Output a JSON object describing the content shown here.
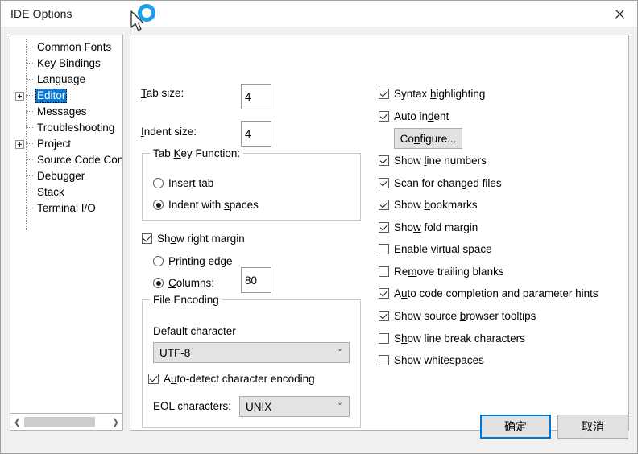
{
  "window": {
    "title": "IDE Options",
    "close_icon": "close-icon",
    "busy_indicator": "loading-spinner-icon"
  },
  "tree": {
    "items": [
      {
        "label": "Common Fonts",
        "expandable": false,
        "selected": false
      },
      {
        "label": "Key Bindings",
        "expandable": false,
        "selected": false
      },
      {
        "label": "Language",
        "expandable": false,
        "selected": false
      },
      {
        "label": "Editor",
        "expandable": true,
        "selected": true
      },
      {
        "label": "Messages",
        "expandable": false,
        "selected": false
      },
      {
        "label": "Troubleshooting",
        "expandable": false,
        "selected": false
      },
      {
        "label": "Project",
        "expandable": true,
        "selected": false
      },
      {
        "label": "Source Code Contro",
        "expandable": false,
        "selected": false
      },
      {
        "label": "Debugger",
        "expandable": false,
        "selected": false
      },
      {
        "label": "Stack",
        "expandable": false,
        "selected": false
      },
      {
        "label": "Terminal I/O",
        "expandable": false,
        "selected": false
      }
    ],
    "scrollbar": {
      "left_arrow": "chevron-left-icon",
      "right_arrow": "chevron-right-icon"
    }
  },
  "editor_page": {
    "tab_size": {
      "label": "Tab size:",
      "mnemonic": "T",
      "value": "4"
    },
    "indent_size": {
      "label": "Indent size:",
      "mnemonic": "I",
      "value": "4"
    },
    "tab_key_function": {
      "title": "Tab Key Function:",
      "options": [
        {
          "label": "Insert tab",
          "mnemonic": "r",
          "checked": false
        },
        {
          "label": "Indent with spaces",
          "mnemonic": "s",
          "checked": true
        }
      ]
    },
    "show_right_margin": {
      "label": "Show right margin",
      "mnemonic": "o",
      "checked": true
    },
    "margin_options": [
      {
        "label": "Printing edge",
        "mnemonic": "P",
        "checked": false
      },
      {
        "label": "Columns:",
        "mnemonic": "C",
        "checked": true
      }
    ],
    "columns_value": "80",
    "file_encoding": {
      "title": "File Encoding",
      "default_character_label": "Default character",
      "default_character_value": "UTF-8",
      "auto_detect": {
        "label": "Auto-detect character encoding",
        "mnemonic": "u",
        "checked": true
      },
      "eol_label": "EOL characters:",
      "eol_mnemonic": "a",
      "eol_value": "UNIX",
      "dropdown_icon": "chevron-down-icon"
    },
    "right_options": [
      {
        "label": "Syntax highlighting",
        "mnemonic": "h",
        "checked": true
      },
      {
        "label": "Auto indent",
        "mnemonic": "d",
        "checked": true
      },
      {
        "label": "Show line numbers",
        "mnemonic": "l",
        "checked": true
      },
      {
        "label": "Scan for changed files",
        "mnemonic": "fi",
        "checked": true
      },
      {
        "label": "Show bookmarks",
        "mnemonic": "b",
        "checked": true
      },
      {
        "label": "Show fold margin",
        "mnemonic": "w",
        "checked": true
      },
      {
        "label": "Enable virtual space",
        "mnemonic": "v",
        "checked": false
      },
      {
        "label": "Remove trailing blanks",
        "mnemonic": "m",
        "checked": false
      },
      {
        "label": "Auto code completion and parameter hints",
        "mnemonic": "u",
        "checked": true
      },
      {
        "label": "Show source browser tooltips",
        "mnemonic": "b",
        "checked": true
      },
      {
        "label": "Show line break characters",
        "mnemonic": "h",
        "checked": false
      },
      {
        "label": "Show whitespaces",
        "mnemonic": "w",
        "checked": false
      }
    ],
    "configure_button": {
      "label": "Configure...",
      "mnemonic": "n"
    }
  },
  "footer": {
    "ok_label": "确定",
    "cancel_label": "取消"
  },
  "colors": {
    "accent": "#0078d7",
    "selection": "#0a7ad4",
    "spinner": "#1e9fe8",
    "panel_bg": "#ffffff",
    "dialog_bg": "#f0f0f0"
  }
}
